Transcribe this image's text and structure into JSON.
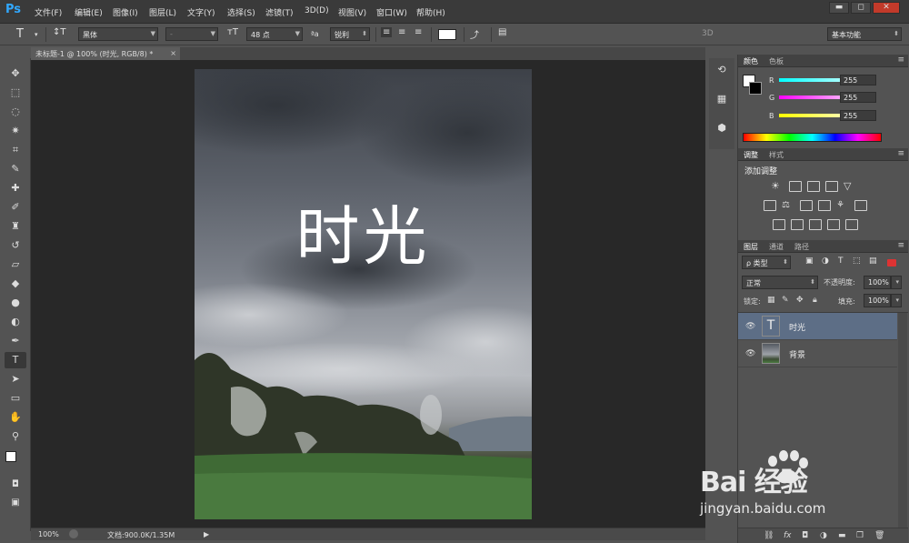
{
  "app": {
    "logo": "Ps"
  },
  "menu": {
    "items": [
      "文件(F)",
      "编辑(E)",
      "图像(I)",
      "图层(L)",
      "文字(Y)",
      "选择(S)",
      "滤镜(T)",
      "3D(D)",
      "视图(V)",
      "窗口(W)",
      "帮助(H)"
    ]
  },
  "window_controls": {
    "minimize": "▬",
    "maximize": "◻",
    "close": "✕"
  },
  "options": {
    "tool_icon": "T",
    "font_family": "黑体",
    "font_style": "-",
    "font_size": "48 点",
    "aa_label": "ªa",
    "antialias": "锐利",
    "three_d": "3D",
    "workspace": "基本功能"
  },
  "document": {
    "tab_title": "未标题-1 @ 100% (时光, RGB/8) *",
    "canvas_text": "时光",
    "zoom": "100%",
    "doc_info": "文档:900.0K/1.35M"
  },
  "panels": {
    "color": {
      "tabs": [
        "颜色",
        "色板"
      ],
      "r_label": "R",
      "g_label": "G",
      "b_label": "B",
      "r": "255",
      "g": "255",
      "b": "255"
    },
    "adjust": {
      "tabs": [
        "调整",
        "样式"
      ],
      "title": "添加调整"
    },
    "layers": {
      "tabs": [
        "图层",
        "通道",
        "路径"
      ],
      "filter": "ρ 类型",
      "blend_mode": "正常",
      "opacity_label": "不透明度:",
      "opacity": "100%",
      "lock_label": "锁定:",
      "fill_label": "填充:",
      "fill": "100%",
      "items": [
        {
          "name": "时光",
          "type": "text",
          "selected": true
        },
        {
          "name": "背景",
          "type": "image",
          "selected": false
        }
      ]
    }
  },
  "watermark": {
    "brand": "Bai 经验",
    "url": "jingyan.baidu.com"
  }
}
